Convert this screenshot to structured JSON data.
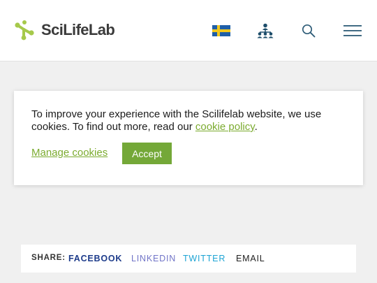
{
  "header": {
    "logo_text": "SciLifeLab",
    "icons": [
      "scilifelab-logo-icon",
      "swedish-flag-icon",
      "network-icon",
      "search-icon",
      "hamburger-menu-icon"
    ]
  },
  "cookie_banner": {
    "text_before": "To improve your experience with the Scilifelab website, we use cookies. To find out more, read our ",
    "policy_link": "cookie policy",
    "text_after": ".",
    "manage_label": "Manage cookies",
    "accept_label": "Accept"
  },
  "share": {
    "label": "SHARE:",
    "facebook": "FACEBOOK",
    "linkedin": "LINKEDIN",
    "twitter": "TWITTER",
    "email": "EMAIL"
  },
  "colors": {
    "brand_green": "#74a838",
    "link_green": "#7bab2f",
    "facebook": "#1d3b8a",
    "linkedin": "#7275c8",
    "twitter": "#1ea4d4"
  }
}
